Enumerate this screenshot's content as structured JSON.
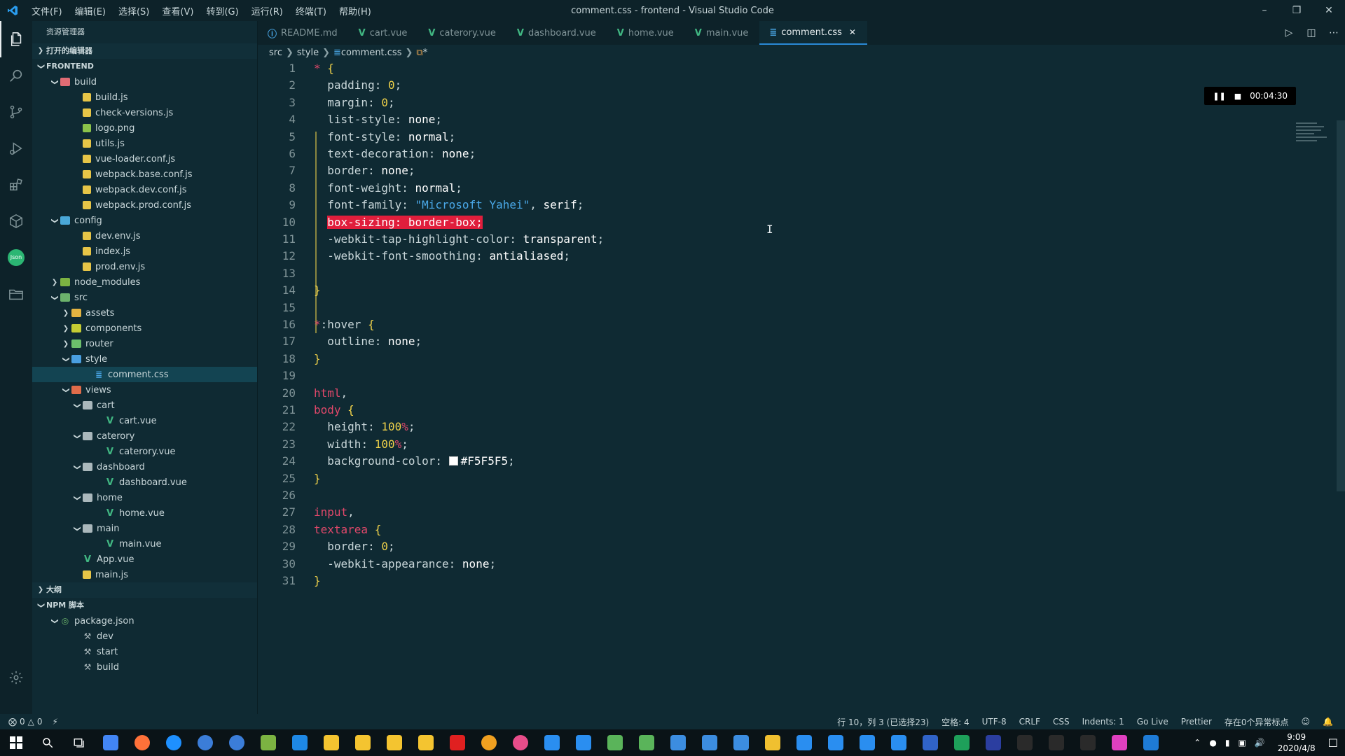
{
  "titlebar": {
    "menus": [
      "文件(F)",
      "编辑(E)",
      "选择(S)",
      "查看(V)",
      "转到(G)",
      "运行(R)",
      "终端(T)",
      "帮助(H)"
    ],
    "title": "comment.css - frontend - Visual Studio Code"
  },
  "sidebar": {
    "title": "资源管理器",
    "open_editors": "打开的编辑器",
    "project": "FRONTEND",
    "outline": "大纲",
    "npm": "NPM 脚本",
    "tree": [
      {
        "label": "build",
        "depth": 1,
        "type": "folder",
        "icon": "folder-build",
        "open": true
      },
      {
        "label": "build.js",
        "depth": 3,
        "type": "js"
      },
      {
        "label": "check-versions.js",
        "depth": 3,
        "type": "js"
      },
      {
        "label": "logo.png",
        "depth": 3,
        "type": "png"
      },
      {
        "label": "utils.js",
        "depth": 3,
        "type": "js"
      },
      {
        "label": "vue-loader.conf.js",
        "depth": 3,
        "type": "js"
      },
      {
        "label": "webpack.base.conf.js",
        "depth": 3,
        "type": "js"
      },
      {
        "label": "webpack.dev.conf.js",
        "depth": 3,
        "type": "js"
      },
      {
        "label": "webpack.prod.conf.js",
        "depth": 3,
        "type": "js"
      },
      {
        "label": "config",
        "depth": 1,
        "type": "folder",
        "icon": "folder-config",
        "open": true
      },
      {
        "label": "dev.env.js",
        "depth": 3,
        "type": "js"
      },
      {
        "label": "index.js",
        "depth": 3,
        "type": "js"
      },
      {
        "label": "prod.env.js",
        "depth": 3,
        "type": "js"
      },
      {
        "label": "node_modules",
        "depth": 1,
        "type": "folder",
        "icon": "folder-node",
        "open": false
      },
      {
        "label": "src",
        "depth": 1,
        "type": "folder",
        "icon": "folder-src",
        "open": true
      },
      {
        "label": "assets",
        "depth": 2,
        "type": "folder",
        "icon": "folder-assets",
        "open": false
      },
      {
        "label": "components",
        "depth": 2,
        "type": "folder",
        "icon": "folder-comp",
        "open": false
      },
      {
        "label": "router",
        "depth": 2,
        "type": "folder",
        "icon": "folder-router",
        "open": false
      },
      {
        "label": "style",
        "depth": 2,
        "type": "folder",
        "icon": "folder-style",
        "open": true
      },
      {
        "label": "comment.css",
        "depth": 4,
        "type": "css",
        "selected": true
      },
      {
        "label": "views",
        "depth": 2,
        "type": "folder",
        "icon": "folder-views",
        "open": true
      },
      {
        "label": "cart",
        "depth": 3,
        "type": "folder",
        "icon": "folder-plain",
        "open": true
      },
      {
        "label": "cart.vue",
        "depth": 5,
        "type": "vue"
      },
      {
        "label": "caterory",
        "depth": 3,
        "type": "folder",
        "icon": "folder-plain",
        "open": true
      },
      {
        "label": "caterory.vue",
        "depth": 5,
        "type": "vue"
      },
      {
        "label": "dashboard",
        "depth": 3,
        "type": "folder",
        "icon": "folder-plain",
        "open": true
      },
      {
        "label": "dashboard.vue",
        "depth": 5,
        "type": "vue"
      },
      {
        "label": "home",
        "depth": 3,
        "type": "folder",
        "icon": "folder-plain",
        "open": true
      },
      {
        "label": "home.vue",
        "depth": 5,
        "type": "vue"
      },
      {
        "label": "main",
        "depth": 3,
        "type": "folder",
        "icon": "folder-plain",
        "open": true
      },
      {
        "label": "main.vue",
        "depth": 5,
        "type": "vue"
      },
      {
        "label": "App.vue",
        "depth": 3,
        "type": "vue"
      },
      {
        "label": "main.js",
        "depth": 3,
        "type": "js"
      }
    ],
    "npm_tree": [
      {
        "label": "package.json",
        "depth": 1,
        "type": "npm"
      },
      {
        "label": "dev",
        "depth": 3,
        "type": "script"
      },
      {
        "label": "start",
        "depth": 3,
        "type": "script"
      },
      {
        "label": "build",
        "depth": 3,
        "type": "script"
      }
    ]
  },
  "tabs": [
    {
      "label": "README.md",
      "icon": "info",
      "active": false
    },
    {
      "label": "cart.vue",
      "icon": "vue",
      "active": false
    },
    {
      "label": "caterory.vue",
      "icon": "vue",
      "active": false
    },
    {
      "label": "dashboard.vue",
      "icon": "vue",
      "active": false
    },
    {
      "label": "home.vue",
      "icon": "vue",
      "active": false
    },
    {
      "label": "main.vue",
      "icon": "vue",
      "active": false
    },
    {
      "label": "comment.css",
      "icon": "css",
      "active": true
    }
  ],
  "breadcrumb": [
    "src",
    "style",
    "comment.css",
    "*"
  ],
  "timer": "00:04:30",
  "code_lines": [
    [
      [
        "k-sel",
        "*"
      ],
      [
        "k-punc",
        " "
      ],
      [
        "k-brace",
        "{"
      ]
    ],
    [
      [
        "k-prop",
        "  padding"
      ],
      [
        "k-punc",
        ": "
      ],
      [
        "k-num",
        "0"
      ],
      [
        "k-punc",
        ";"
      ]
    ],
    [
      [
        "k-prop",
        "  margin"
      ],
      [
        "k-punc",
        ": "
      ],
      [
        "k-num",
        "0"
      ],
      [
        "k-punc",
        ";"
      ]
    ],
    [
      [
        "k-prop",
        "  list-style"
      ],
      [
        "k-punc",
        ": "
      ],
      [
        "k-val",
        "none"
      ],
      [
        "k-punc",
        ";"
      ]
    ],
    [
      [
        "k-prop",
        "  font-style"
      ],
      [
        "k-punc",
        ": "
      ],
      [
        "k-val",
        "normal"
      ],
      [
        "k-punc",
        ";"
      ]
    ],
    [
      [
        "k-prop",
        "  text-decoration"
      ],
      [
        "k-punc",
        ": "
      ],
      [
        "k-val",
        "none"
      ],
      [
        "k-punc",
        ";"
      ]
    ],
    [
      [
        "k-prop",
        "  border"
      ],
      [
        "k-punc",
        ": "
      ],
      [
        "k-val",
        "none"
      ],
      [
        "k-punc",
        ";"
      ]
    ],
    [
      [
        "k-prop",
        "  font-weight"
      ],
      [
        "k-punc",
        ": "
      ],
      [
        "k-val",
        "normal"
      ],
      [
        "k-punc",
        ";"
      ]
    ],
    [
      [
        "k-prop",
        "  font-family"
      ],
      [
        "k-punc",
        ": "
      ],
      [
        "k-str",
        "\"Microsoft Yahei\""
      ],
      [
        "k-punc",
        ", "
      ],
      [
        "k-val",
        "serif"
      ],
      [
        "k-punc",
        ";"
      ]
    ],
    [
      [
        "k-punc",
        "  "
      ],
      [
        "hl",
        "box-sizing: border-box;"
      ]
    ],
    [
      [
        "k-prop",
        "  -webkit-tap-highlight-color"
      ],
      [
        "k-punc",
        ": "
      ],
      [
        "k-val",
        "transparent"
      ],
      [
        "k-punc",
        ";"
      ]
    ],
    [
      [
        "k-prop",
        "  -webkit-font-smoothing"
      ],
      [
        "k-punc",
        ": "
      ],
      [
        "k-val",
        "antialiased"
      ],
      [
        "k-punc",
        ";"
      ]
    ],
    [],
    [
      [
        "k-brace",
        "}"
      ]
    ],
    [],
    [
      [
        "k-sel",
        "*"
      ],
      [
        "k-prop",
        ":hover"
      ],
      [
        "k-punc",
        " "
      ],
      [
        "k-brace",
        "{"
      ]
    ],
    [
      [
        "k-prop",
        "  outline"
      ],
      [
        "k-punc",
        ": "
      ],
      [
        "k-val",
        "none"
      ],
      [
        "k-punc",
        ";"
      ]
    ],
    [
      [
        "k-brace",
        "}"
      ]
    ],
    [],
    [
      [
        "k-sel",
        "html"
      ],
      [
        "k-punc",
        ","
      ]
    ],
    [
      [
        "k-sel",
        "body"
      ],
      [
        "k-punc",
        " "
      ],
      [
        "k-brace",
        "{"
      ]
    ],
    [
      [
        "k-prop",
        "  height"
      ],
      [
        "k-punc",
        ": "
      ],
      [
        "k-num",
        "100"
      ],
      [
        "k-unit",
        "%"
      ],
      [
        "k-punc",
        ";"
      ]
    ],
    [
      [
        "k-prop",
        "  width"
      ],
      [
        "k-punc",
        ": "
      ],
      [
        "k-num",
        "100"
      ],
      [
        "k-unit",
        "%"
      ],
      [
        "k-punc",
        ";"
      ]
    ],
    [
      [
        "k-prop",
        "  background-color"
      ],
      [
        "k-punc",
        ": "
      ],
      [
        "swatch",
        ""
      ],
      [
        "k-val",
        "#F5F5F5"
      ],
      [
        "k-punc",
        ";"
      ]
    ],
    [
      [
        "k-brace",
        "}"
      ]
    ],
    [],
    [
      [
        "k-sel",
        "input"
      ],
      [
        "k-punc",
        ","
      ]
    ],
    [
      [
        "k-sel",
        "textarea"
      ],
      [
        "k-punc",
        " "
      ],
      [
        "k-brace",
        "{"
      ]
    ],
    [
      [
        "k-prop",
        "  border"
      ],
      [
        "k-punc",
        ": "
      ],
      [
        "k-num",
        "0"
      ],
      [
        "k-punc",
        ";"
      ]
    ],
    [
      [
        "k-prop",
        "  -webkit-appearance"
      ],
      [
        "k-punc",
        ": "
      ],
      [
        "k-val",
        "none"
      ],
      [
        "k-punc",
        ";"
      ]
    ],
    [
      [
        "k-brace",
        "}"
      ]
    ]
  ],
  "statusbar": {
    "errors": "0",
    "warnings": "0",
    "position": "行 10，列 3 (已选择23)",
    "spaces": "空格: 4",
    "encoding": "UTF-8",
    "eol": "CRLF",
    "language": "CSS",
    "indents": "Indents: 1",
    "golive": "Go Live",
    "prettier": "Prettier",
    "exceptions": "存在0个异常标点"
  },
  "taskbar": {
    "time": "9:09",
    "date": "2020/4/8",
    "apps": [
      "#4285f4",
      "#ff7139",
      "#1e90ff",
      "#3b7dd8",
      "#3b7dd8",
      "#7cb342",
      "#1e88e5",
      "#f4c430",
      "#f4c430",
      "#f4c430",
      "#f4c430",
      "#e02020",
      "#f0a020",
      "#e84d8a",
      "#2a8ef0",
      "#2a8ef0",
      "#5ab45a",
      "#5ab45a",
      "#3c8de0",
      "#3c8de0",
      "#3c8de0",
      "#f0c030",
      "#2a8ef0",
      "#2a8ef0",
      "#2a8ef0",
      "#2a8ef0",
      "#3063c8",
      "#1ea05a",
      "#2b3ea0",
      "#2a2a2a",
      "#2a2a2a",
      "#2a2a2a",
      "#e040c0",
      "#1e7bd6"
    ]
  },
  "colors": {
    "accent": "#2a89d6",
    "highlight": "#e01e3c",
    "background": "#0f2a33"
  }
}
